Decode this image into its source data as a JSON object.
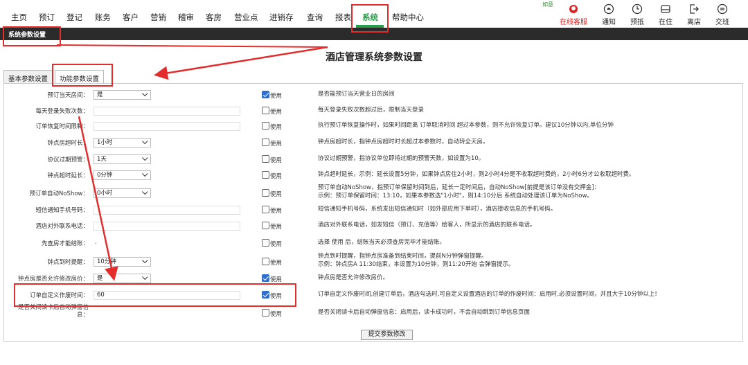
{
  "nav": {
    "menu": [
      "主页",
      "预订",
      "登记",
      "账务",
      "客户",
      "营销",
      "稽审",
      "客房",
      "营业点",
      "进销存",
      "查询",
      "报表",
      "系统",
      "帮助中心"
    ],
    "active": "系统",
    "topright_label": "如意",
    "service_label": "在线客服",
    "right_buttons": [
      {
        "label": "通知",
        "icon": "bell-icon"
      },
      {
        "label": "预抵",
        "icon": "clock-icon"
      },
      {
        "label": "在住",
        "icon": "bed-icon"
      },
      {
        "label": "离店",
        "icon": "exit-icon"
      },
      {
        "label": "交班",
        "icon": "handover-icon"
      }
    ]
  },
  "breadcrumb": "系统参数设置",
  "page_title": "酒店管理系统参数设置",
  "tabs": [
    "基本参数设置",
    "功能参数设置"
  ],
  "active_tab": "功能参数设置",
  "use_label": "使用",
  "rows": [
    {
      "label": "预订当天房间：",
      "type": "select",
      "value": "是",
      "checked": true,
      "desc": [
        "是否能预订当天营业日的房间"
      ]
    },
    {
      "label": "每天登录失败次数：",
      "type": "text",
      "value": "",
      "checked": false,
      "desc": [
        "每天登录失败次数超过后，限制当天登录"
      ]
    },
    {
      "label": "订单恢复时间限制：",
      "type": "text",
      "value": "",
      "checked": false,
      "desc": [
        "执行预订单恢复操作时，如果时间距离 订单取消时间 超过本参数，则不允许恢复订单。建议10分钟以内,单位分钟"
      ]
    },
    {
      "label": "钟点房超时长：",
      "type": "select",
      "value": "1小时",
      "checked": false,
      "desc": [
        "钟点房超时长，指钟点房超时时长超过本参数时，自动转全天房。"
      ]
    },
    {
      "label": "协议过期预警：",
      "type": "select",
      "value": "1天",
      "checked": false,
      "desc": [
        "协议过期预警，指协议单位即将过期的预警天数，如设置为10。"
      ]
    },
    {
      "label": "钟点超时延长：",
      "type": "select",
      "value": "0分钟",
      "checked": false,
      "desc": [
        "钟点超时延长，示例：延长设置5分钟，如果钟点房住2小时，则2小时4分是不收取超时费的，2小时6分才公收取超时费。"
      ]
    },
    {
      "label": "预订单自动NoShow：",
      "type": "select",
      "value": "0小时",
      "checked": false,
      "desc": [
        "预订单自动NoShow，指预订单保留时间到后，延长一定时间后，自动NoShow[前提是该订单没有交押金]：",
        "示例：预订单保留时间：13:10，如果本参数选\"1小时\"，则14:10分后 系统自动处理该订单为NoShow。"
      ]
    },
    {
      "label": "短信通知手机号码：",
      "type": "text",
      "value": "",
      "checked": false,
      "desc": [
        "短信通知手机号码，系统发出短信通知时（如外部应用下单时），酒店接收信息的手机号码。"
      ]
    },
    {
      "label": "酒店对外联系电话：",
      "type": "text",
      "value": "",
      "checked": false,
      "desc": [
        "酒店对外联系电话，如发短信（预订、充值等）给客人，所显示的酒店的联系电话。"
      ]
    },
    {
      "label": "先查房才能结账：",
      "type": "none",
      "value": ".",
      "checked": false,
      "desc": [
        "选择 使用 后，结账当天必须查房完毕才能结账。"
      ]
    },
    {
      "label": "钟点到时提醒：",
      "type": "select",
      "value": "10分钟",
      "checked": false,
      "desc": [
        "钟点到时提醒，指钟点房准备到结束时间，提前N分钟弹窗提醒。",
        "示例：钟点房A 11:30结束，本设置为10分钟，则11:20开始 会弹窗提示。"
      ]
    },
    {
      "label": "钟点房是否允许修改房价：",
      "type": "select",
      "value": "是",
      "checked": true,
      "desc": [
        "钟点房是否允许修改房价。"
      ]
    },
    {
      "label": "订单自定义作废时间：",
      "type": "text",
      "value": "60",
      "checked": true,
      "desc": [
        "订单自定义作废时间,创建订单后，酒店勾选时,可自定义设置酒店的订单的作废时间：启用时,必须设置时间，并且大于10分钟以上!"
      ]
    },
    {
      "label": "是否关闭读卡后自动弹窗信息：",
      "type": "none",
      "value": "",
      "checked": false,
      "desc": [
        "是否关闭读卡后自动弹窗信息：启用后，读卡成功时，不会自动跳到订单信息页面"
      ]
    }
  ],
  "submit_label": "提交参数修改",
  "colors": {
    "accent": "#2a9d4a",
    "highlight": "#e32d2d",
    "checkbox": "#2f6fd1",
    "dark_bar": "#2b2b2b"
  }
}
